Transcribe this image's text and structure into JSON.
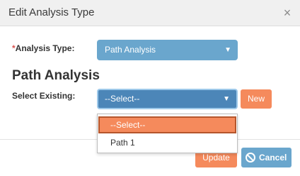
{
  "dialog": {
    "title": "Edit Analysis Type",
    "close_symbol": "×"
  },
  "form": {
    "analysis_type_required_mark": "*",
    "analysis_type_label": "Analysis Type:",
    "analysis_type_value": "Path Analysis",
    "section_title": "Path Analysis",
    "select_existing_label": "Select Existing:",
    "select_existing_value": "--Select--",
    "new_button": "New"
  },
  "dropdown": {
    "options": [
      "--Select--",
      "Path 1"
    ],
    "selected_index": 0
  },
  "footer": {
    "update_button": "Update",
    "cancel_button": "Cancel"
  },
  "icons": {
    "close": "close-icon",
    "caret": "chevron-down-icon",
    "cancel": "ban-icon"
  },
  "colors": {
    "accent_orange": "#f58a5c",
    "accent_blue": "#6aa6cd",
    "focused_select": "#4c86b8",
    "required": "#d9534f"
  }
}
